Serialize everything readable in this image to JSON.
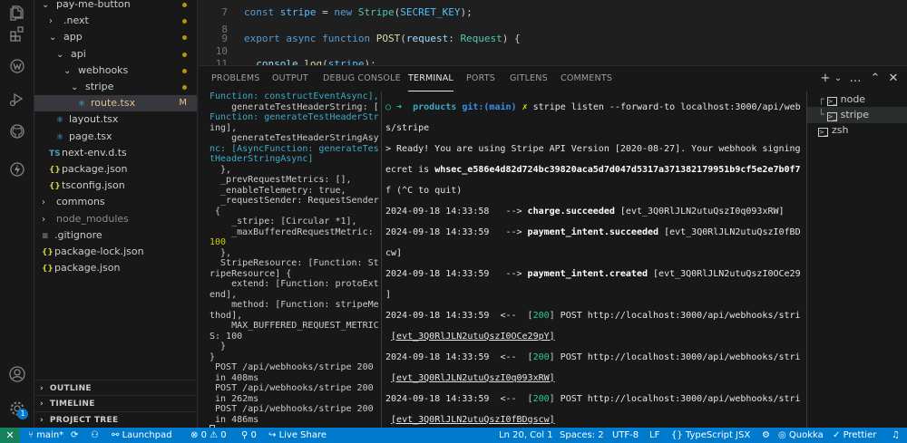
{
  "explorer": {
    "items": [
      {
        "label": "pay-me-button",
        "kind": "folder-open",
        "depth": 0,
        "dot": true
      },
      {
        "label": ".next",
        "kind": "folder",
        "depth": 1,
        "dot": true
      },
      {
        "label": "app",
        "kind": "folder-open",
        "depth": 1,
        "dot": true
      },
      {
        "label": "api",
        "kind": "folder-open",
        "depth": 2,
        "dot": true
      },
      {
        "label": "webhooks",
        "kind": "folder-open",
        "depth": 3,
        "dot": true
      },
      {
        "label": "stripe",
        "kind": "folder-open",
        "depth": 4,
        "dot": true
      },
      {
        "label": "route.tsx",
        "kind": "tsx",
        "depth": 5,
        "flag": "M",
        "selected": true
      },
      {
        "label": "layout.tsx",
        "kind": "tsx",
        "depth": 2
      },
      {
        "label": "page.tsx",
        "kind": "tsx",
        "depth": 2
      },
      {
        "label": "next-env.d.ts",
        "kind": "ts",
        "depth": 1
      },
      {
        "label": "package.json",
        "kind": "json",
        "depth": 1
      },
      {
        "label": "tsconfig.json",
        "kind": "json",
        "depth": 1
      },
      {
        "label": "commons",
        "kind": "folder",
        "depth": 0
      },
      {
        "label": "node_modules",
        "kind": "folder",
        "depth": 0,
        "dimmed": true
      },
      {
        "label": ".gitignore",
        "kind": "text",
        "depth": 0
      },
      {
        "label": "package-lock.json",
        "kind": "json",
        "depth": 0
      },
      {
        "label": "package.json",
        "kind": "json",
        "depth": 0
      }
    ],
    "sections": [
      "OUTLINE",
      "TIMELINE",
      "PROJECT TREE"
    ]
  },
  "editor": {
    "lines": [
      {
        "num": "7",
        "text": "const stripe = new Stripe(SECRET_KEY);"
      },
      {
        "num": "8",
        "text": ""
      },
      {
        "num": "9",
        "text": "export async function POST(request: Request) {"
      },
      {
        "num": "10",
        "text": ""
      },
      {
        "num": "11",
        "text": "  console.log(stripe);"
      }
    ]
  },
  "panel": {
    "tabs": [
      "PROBLEMS",
      "OUTPUT",
      "DEBUG CONSOLE",
      "TERMINAL",
      "PORTS",
      "GITLENS",
      "COMMENTS"
    ],
    "active_tab": "TERMINAL",
    "controls": [
      "+",
      "⌄",
      "…",
      "⌃",
      "✕"
    ]
  },
  "terminal_left": [
    "Function: constructEventAsync],",
    "    generateTestHeaderString: [",
    "Function: generateTestHeaderStr",
    "ing],",
    "    generateTestHeaderStringAsy",
    "nc: [AsyncFunction: generateTes",
    "tHeaderStringAsync]",
    "  },",
    "  _prevRequestMetrics: [],",
    "  _enableTelemetry: true,",
    "  _requestSender: RequestSender",
    " {",
    "    _stripe: [Circular *1],",
    "    _maxBufferedRequestMetric: ",
    "100",
    "  },",
    "  StripeResource: [Function: St",
    "ripeResource] {",
    "    extend: [Function: protoExt",
    "end],",
    "    method: [Function: stripeMe",
    "thod],",
    "    MAX_BUFFERED_REQUEST_METRIC",
    "S: 100",
    "  }",
    "}",
    " POST /api/webhooks/stripe 200",
    " in 408ms",
    " POST /api/webhooks/stripe 200",
    " in 262ms",
    " POST /api/webhooks/stripe 200",
    " in 486ms"
  ],
  "terminal_right": {
    "prompt_dir": "products",
    "prompt_git": "git:(main)",
    "command": "stripe listen --forward-to localhost:3000/api/webhook",
    "command_wrap": "s/stripe",
    "ready_1": "> Ready! You are using Stripe API Version [2020-08-27]. Your webhook signing s",
    "ready_2a": "ecret is ",
    "secret": "whsec_e586e4d82d724bc39820aca5d7d047d5317a371382179951b9cf5e2e7b0f7ec",
    "ready_3": "f (^C to quit)",
    "events": [
      {
        "time": "2024-09-18 14:33:58",
        "arrow": "-->",
        "type": "charge.succeeded",
        "id": "[evt_3Q0RlJLN2utuQszI0q093xRW]"
      },
      {
        "time": "2024-09-18 14:33:59",
        "arrow": "-->",
        "type": "payment_intent.succeeded",
        "id": "[evt_3Q0RlJLN2utuQszI0fBDgs",
        "wrap": "cw]"
      },
      {
        "time": "2024-09-18 14:33:59",
        "arrow": "-->",
        "type": "payment_intent.created",
        "id": "[evt_3Q0RlJLN2utuQszI0OCe29pY",
        "wrap": "]"
      }
    ],
    "responses": [
      {
        "time": "2024-09-18 14:33:59",
        "arrow": "<--",
        "status": "200",
        "req": "POST http://localhost:3000/api/webhooks/stripe",
        "id": "[evt_3Q0RlJLN2utuQszI0OCe29pY]"
      },
      {
        "time": "2024-09-18 14:33:59",
        "arrow": "<--",
        "status": "200",
        "req": "POST http://localhost:3000/api/webhooks/stripe",
        "id": "[evt_3Q0RlJLN2utuQszI0q093xRW]"
      },
      {
        "time": "2024-09-18 14:33:59",
        "arrow": "<--",
        "status": "200",
        "req": "POST http://localhost:3000/api/webhooks/stripe",
        "id": "[evt_3Q0RlJLN2utuQszI0fBDgscw]"
      }
    ]
  },
  "terminal_list": [
    {
      "label": "node",
      "active": false
    },
    {
      "label": "stripe",
      "active": true
    },
    {
      "label": "zsh",
      "active": false
    }
  ],
  "statusbar": {
    "branch": "main*",
    "launchpad": "Launchpad",
    "errors": "0",
    "warnings": "0",
    "ports": "0",
    "live_share": "Live Share",
    "position": "Ln 20, Col 1",
    "spaces": "Spaces: 2",
    "encoding": "UTF-8",
    "eol": "LF",
    "language": "TypeScript JSX",
    "quokka": "Quokka",
    "prettier": "Prettier"
  },
  "activity": {
    "icons": [
      "files-icon",
      "search-icon",
      "source-control-icon",
      "run-debug-icon",
      "extensions-icon",
      "remote-explorer-icon",
      "github-icon",
      "lightning-icon",
      "account-icon",
      "settings-icon"
    ],
    "settings_badge": "1"
  }
}
